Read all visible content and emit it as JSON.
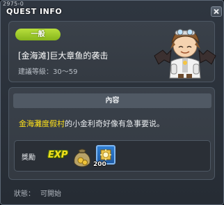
{
  "window": {
    "quest_id": "2975-0",
    "title": "QUEST INFO"
  },
  "header": {
    "badge": "一般",
    "quest_name": "[金海滩]巨大章鱼的袭击",
    "level_requirement": "建議等級：30～59"
  },
  "content": {
    "section_title": "內容",
    "description_highlight": "金海灘度假村",
    "description_rest": "的小金利奇好像有急事要说。"
  },
  "reward": {
    "label": "獎勵",
    "exp_text": "EXP",
    "item_count": "200"
  },
  "status": {
    "label": "狀態：",
    "value": "可開始"
  },
  "colors": {
    "badge_green": "#9ccd2a",
    "highlight_yellow": "#ffe21a",
    "panel_bg": "#373d45"
  }
}
